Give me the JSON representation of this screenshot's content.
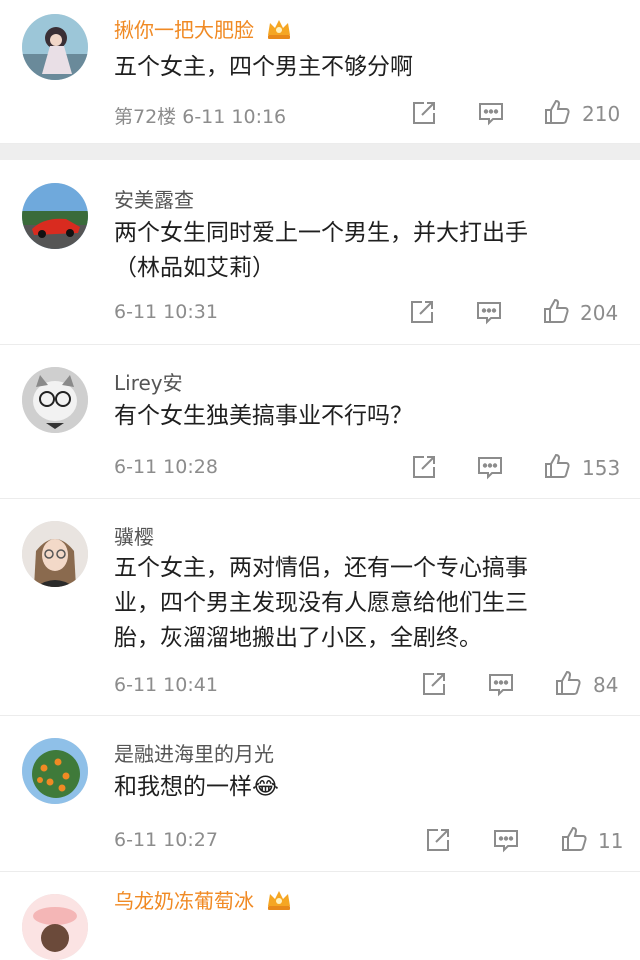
{
  "comments": [
    {
      "username": "揪你一把大肥脸",
      "vip": true,
      "text": [
        "五个女主，四个男主不够分啊"
      ],
      "floor": "第72楼",
      "time": "6-11 10:16",
      "likes": "210"
    },
    {
      "username": "安美露查",
      "vip": false,
      "text": [
        "两个女生同时爱上一个男生，并大打出手",
        "（林品如艾莉）"
      ],
      "floor": "",
      "time": "6-11 10:31",
      "likes": "204"
    },
    {
      "username": "Lirey安",
      "vip": false,
      "text": [
        "有个女生独美搞事业不行吗？"
      ],
      "floor": "",
      "time": "6-11 10:28",
      "likes": "153"
    },
    {
      "username": "骥樱",
      "vip": false,
      "text": [
        "五个女主，两对情侣，还有一个专心搞事",
        "业，四个男主发现没有人愿意给他们生三",
        "胎，灰溜溜地搬出了小区，全剧终。"
      ],
      "floor": "",
      "time": "6-11 10:41",
      "likes": "84"
    },
    {
      "username": "是融进海里的月光",
      "vip": false,
      "text": [
        "和我想的一样😂"
      ],
      "floor": "",
      "time": "6-11 10:27",
      "likes": "11"
    },
    {
      "username": "乌龙奶冻葡萄冰",
      "vip": true,
      "text": [],
      "floor": "",
      "time": "",
      "likes": ""
    }
  ],
  "icons": {
    "share": "share-icon",
    "reply": "comment-icon",
    "like": "thumbs-up-icon",
    "vip": "crown-badge-icon"
  },
  "colors": {
    "vip_name": "#f08a24",
    "meta": "#8c8c8c",
    "separator": "#eeeeee"
  }
}
